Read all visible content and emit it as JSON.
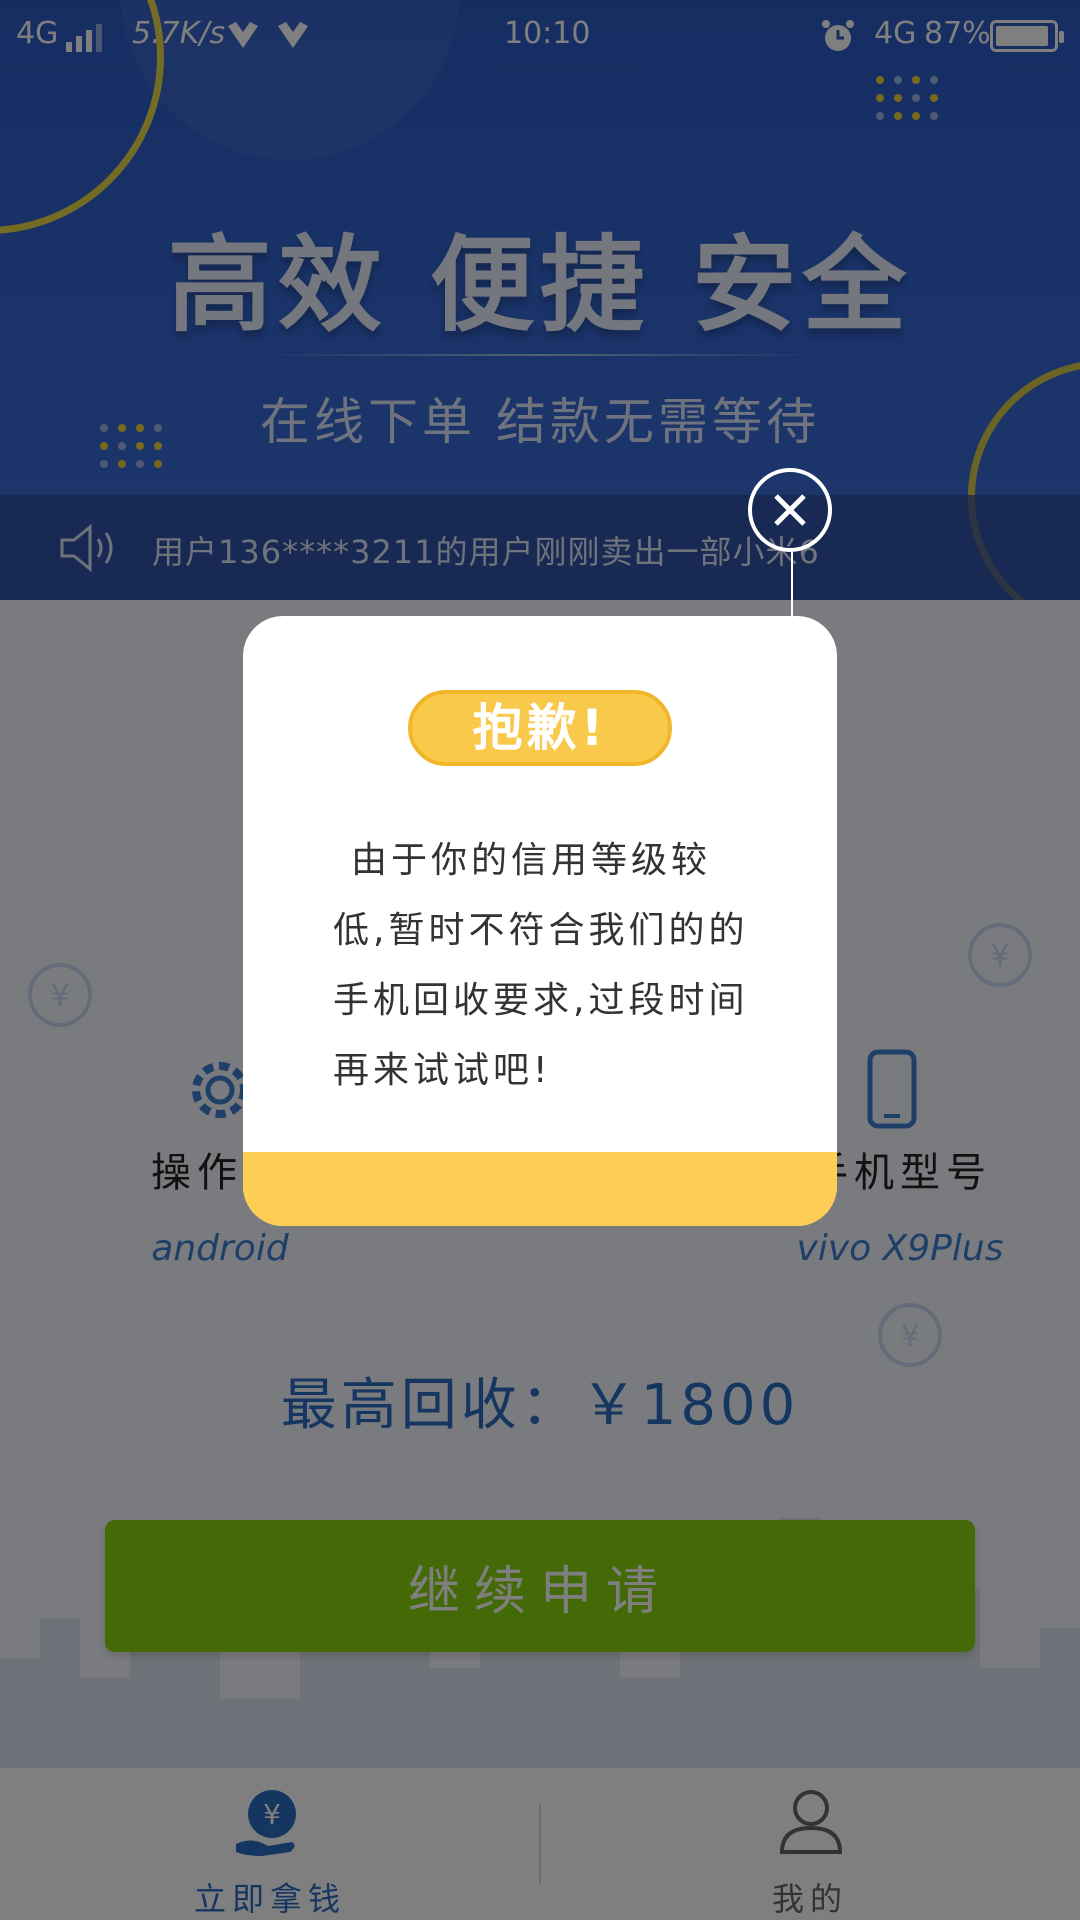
{
  "status_bar": {
    "network": "4G",
    "speed": "5.7K/s",
    "time": "10:10",
    "network_right": "4G",
    "battery": "87%"
  },
  "hero": {
    "title": "高效 便捷 安全",
    "subtitle": "在线下单 结款无需等待"
  },
  "notice": {
    "text": "用户136****3211的用户刚刚卖出一部小米6"
  },
  "info": {
    "os_label": "操作系",
    "os_value": "android",
    "model_label": "手机型号",
    "model_value": "vivo X9Plus"
  },
  "price": {
    "text": "最高回收：￥1800"
  },
  "apply_button": {
    "label": "继续申请"
  },
  "tabbar": {
    "tab1": "立即拿钱",
    "tab2": "我的"
  },
  "dialog": {
    "badge": "抱歉!",
    "message": "由于你的信用等级较低,暂时不符合我们的的手机回收要求,过段时间再来试试吧!"
  },
  "colors": {
    "accent_blue": "#2d6cc5",
    "apply_green": "#86d50f",
    "badge_yellow": "#f8c94a",
    "footer_yellow": "#fdcd55"
  }
}
